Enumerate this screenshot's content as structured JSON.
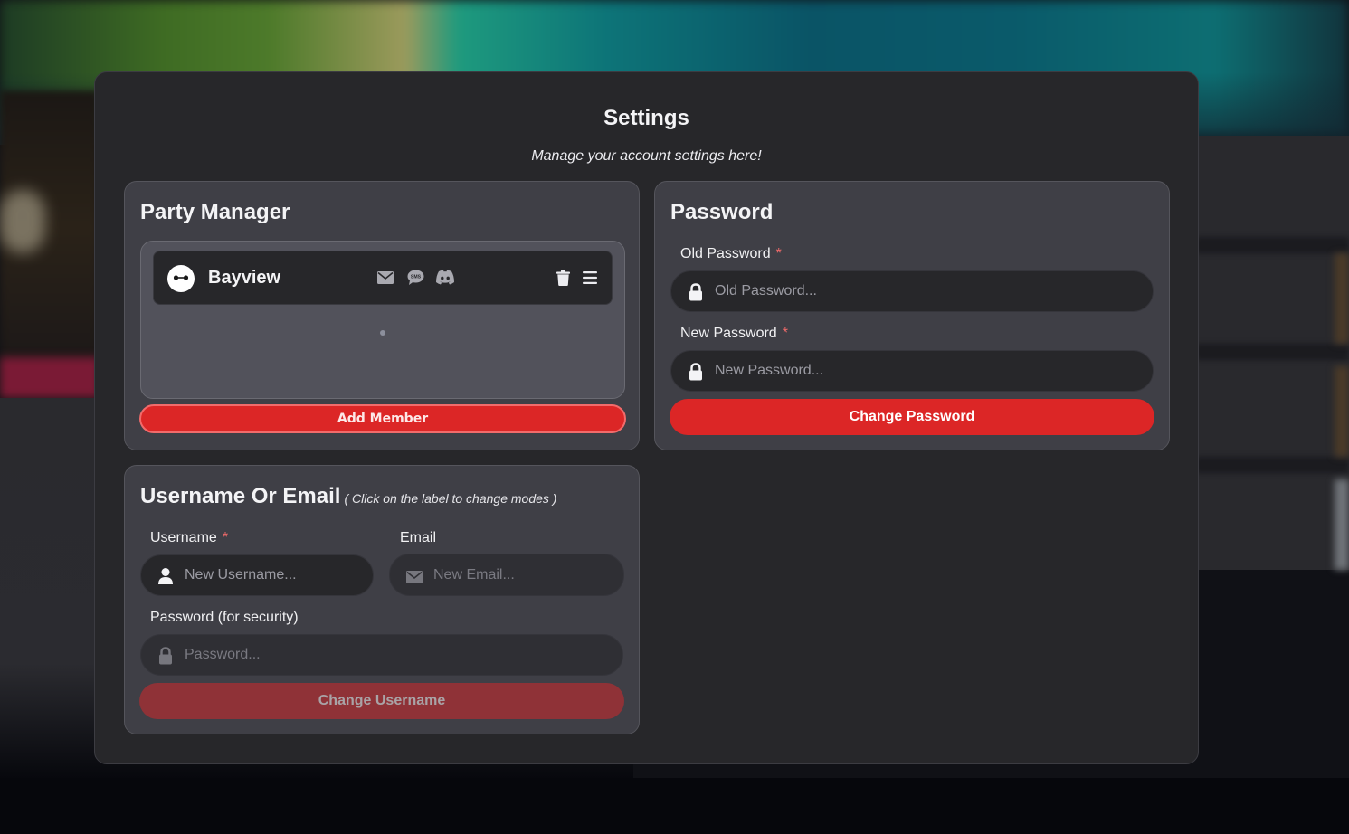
{
  "modal": {
    "title": "Settings",
    "subtitle": "Manage your account settings here!"
  },
  "party_manager": {
    "title": "Party Manager",
    "members": [
      {
        "name": "Bayview",
        "avatar": "baymax-avatar",
        "contact_icons": [
          "email-icon",
          "sms-icon",
          "discord-icon"
        ],
        "action_icons": [
          "trash-icon",
          "menu-icon"
        ]
      }
    ],
    "add_member_label": "Add Member"
  },
  "password": {
    "title": "Password",
    "old_label": "Old Password",
    "old_placeholder": "Old Password...",
    "new_label": "New Password",
    "new_placeholder": "New Password...",
    "required_mark": "*",
    "submit_label": "Change Password"
  },
  "username_or_email": {
    "title": "Username Or Email",
    "hint": "( Click on the label to change modes )",
    "username_label": "Username",
    "username_placeholder": "New Username...",
    "email_label": "Email",
    "email_placeholder": "New Email...",
    "security_label": "Password (for security)",
    "security_placeholder": "Password...",
    "required_mark": "*",
    "submit_label": "Change Username",
    "submit_disabled": true,
    "active_mode": "Username"
  },
  "colors": {
    "accent_red": "#dc2626",
    "disabled_red": "#8f3237",
    "modal_bg": "#27272a",
    "card_bg": "#3f3f46",
    "required_star": "#f06a6a"
  }
}
